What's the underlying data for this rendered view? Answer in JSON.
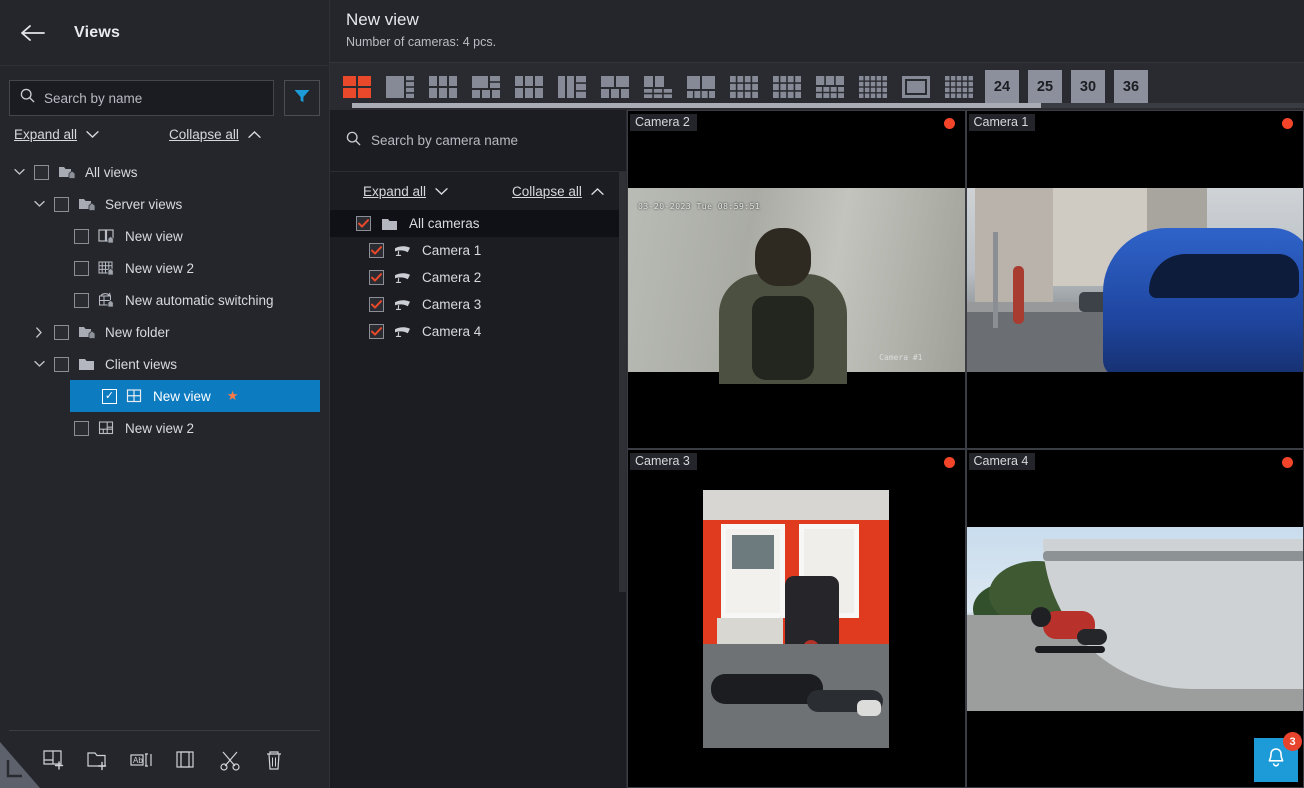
{
  "sidebar": {
    "title": "Views",
    "back_icon": "back-arrow-icon",
    "search": {
      "placeholder": "Search by name",
      "value": "",
      "icon": "search-icon"
    },
    "filter_icon": "filter-funnel-icon",
    "expand_all": "Expand all",
    "collapse_all": "Collapse all",
    "tree": [
      {
        "label": "All views",
        "indent": 0,
        "caret": "down",
        "checked": false,
        "icon": "folder-home-icon",
        "selected": false,
        "star": false
      },
      {
        "label": "Server views",
        "indent": 1,
        "caret": "down",
        "checked": false,
        "icon": "folder-home-icon",
        "selected": false,
        "star": false
      },
      {
        "label": "New view",
        "indent": 2,
        "caret": "none",
        "checked": false,
        "icon": "layout-2-home-icon",
        "selected": false,
        "star": false
      },
      {
        "label": "New view 2",
        "indent": 2,
        "caret": "none",
        "checked": false,
        "icon": "layout-grid-home-icon",
        "selected": false,
        "star": false
      },
      {
        "label": "New automatic switching",
        "indent": 2,
        "caret": "none",
        "checked": false,
        "icon": "layout-switch-home-icon",
        "selected": false,
        "star": false
      },
      {
        "label": "New folder",
        "indent": 1,
        "caret": "right",
        "checked": false,
        "icon": "folder-home-icon",
        "selected": false,
        "star": false
      },
      {
        "label": "Client views",
        "indent": 1,
        "caret": "down",
        "checked": false,
        "icon": "folder-icon",
        "selected": false,
        "star": false
      },
      {
        "label": "New view",
        "indent": 2,
        "caret": "none",
        "checked": true,
        "icon": "layout-quad-icon",
        "selected": true,
        "star": true
      },
      {
        "label": "New view 2",
        "indent": 2,
        "caret": "none",
        "checked": false,
        "icon": "layout-mixed-icon",
        "selected": false,
        "star": false
      }
    ],
    "footer_buttons": [
      {
        "name": "add-view-button",
        "title": "Add view"
      },
      {
        "name": "add-folder-button",
        "title": "Add folder"
      },
      {
        "name": "rename-button",
        "title": "Rename"
      },
      {
        "name": "copy-button",
        "title": "Copy"
      },
      {
        "name": "cut-button",
        "title": "Cut"
      },
      {
        "name": "delete-button",
        "title": "Delete"
      }
    ]
  },
  "main": {
    "view_title": "New view",
    "view_subtitle": "Number of cameras: 4 pcs.",
    "layout_numbers": [
      "24",
      "25",
      "30",
      "36"
    ],
    "selected_layout_index": 0,
    "accent_color": "#e8492b",
    "selection_color": "#0c7bc0",
    "layout_icons": [
      "layout-2x2",
      "layout-1-plus-4-right",
      "layout-6-left",
      "layout-top2-bottom3",
      "layout-3x2",
      "layout-2-plus-3-right",
      "layout-2-plus-4",
      "layout-2-plus-6",
      "layout-1-plus-5-bottom",
      "layout-4x3",
      "layout-3x3-mixed",
      "layout-4x3-b",
      "layout-5x4",
      "layout-center-highlight",
      "layout-5x4-b"
    ]
  },
  "camera_panel": {
    "search": {
      "placeholder": "Search by camera name",
      "icon": "search-icon"
    },
    "expand_all": "Expand all",
    "collapse_all": "Collapse all",
    "tree": [
      {
        "label": "All cameras",
        "indent": 0,
        "checked": true,
        "icon": "folder-icon",
        "highlighted": true
      },
      {
        "label": "Camera 1",
        "indent": 1,
        "checked": true,
        "icon": "camera-icon",
        "highlighted": false
      },
      {
        "label": "Camera 2",
        "indent": 1,
        "checked": true,
        "icon": "camera-icon",
        "highlighted": false
      },
      {
        "label": "Camera 3",
        "indent": 1,
        "checked": true,
        "icon": "camera-icon",
        "highlighted": false
      },
      {
        "label": "Camera 4",
        "indent": 1,
        "checked": true,
        "icon": "camera-icon",
        "highlighted": false
      }
    ]
  },
  "video_tiles": [
    {
      "label": "Camera 2",
      "recording": true,
      "scene": "corridor",
      "overlay_timestamp": "03-20-2023 Tue 08:59:51",
      "overlay_camera": "Camera #1"
    },
    {
      "label": "Camera 1",
      "recording": true,
      "scene": "street",
      "overlay_timestamp": "",
      "overlay_camera": ""
    },
    {
      "label": "Camera 3",
      "recording": true,
      "scene": "gym",
      "overlay_timestamp": "",
      "overlay_camera": ""
    },
    {
      "label": "Camera 4",
      "recording": true,
      "scene": "skatepark",
      "overlay_timestamp": "",
      "overlay_camera": ""
    }
  ],
  "notifications": {
    "icon": "bell-icon",
    "count": "3",
    "color": "#1d9bd8",
    "badge_color": "#e8432c"
  }
}
